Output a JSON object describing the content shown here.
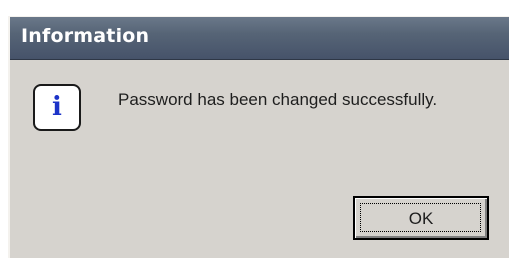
{
  "dialog": {
    "title": "Information",
    "icon": "information-icon",
    "icon_glyph": "i",
    "message": "Password has been changed successfully.",
    "ok_label": "OK"
  },
  "colors": {
    "face": "#d6d3ce",
    "titlebar": "#566476",
    "icon_accent": "#1c33c8"
  }
}
